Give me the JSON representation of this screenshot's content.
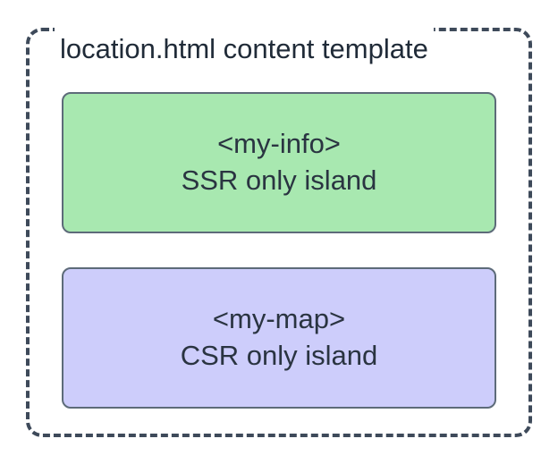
{
  "template": {
    "title": "location.html content template"
  },
  "islands": {
    "ssr": {
      "tag": "<my-info>",
      "label": "SSR only island"
    },
    "csr": {
      "tag": "<my-map>",
      "label": "CSR only island"
    }
  }
}
